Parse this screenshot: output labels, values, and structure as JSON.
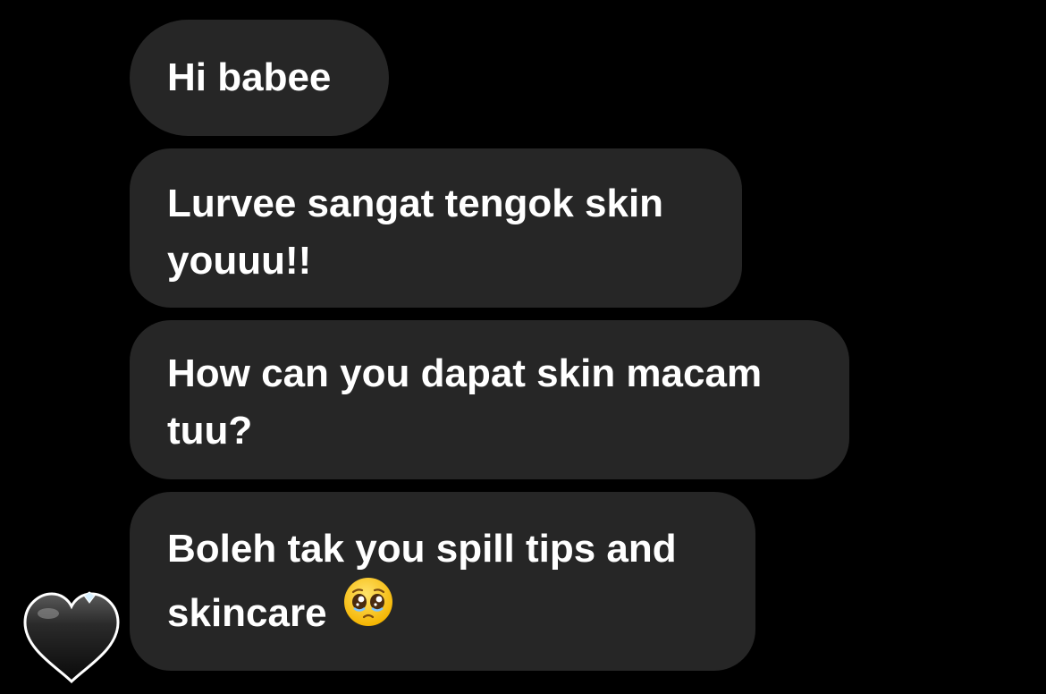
{
  "messages": [
    {
      "text": "Hi babee"
    },
    {
      "text": "Lurvee sangat tengok skin youuu!!"
    },
    {
      "text": "How can you dapat skin macam tuu?"
    },
    {
      "text": "Boleh tak you spill tips and skincare",
      "emoji": "pleading-face-icon"
    }
  ],
  "avatar": {
    "icon": "black-heart-icon"
  },
  "colors": {
    "background": "#000000",
    "bubble": "#262626",
    "text": "#ffffff"
  }
}
